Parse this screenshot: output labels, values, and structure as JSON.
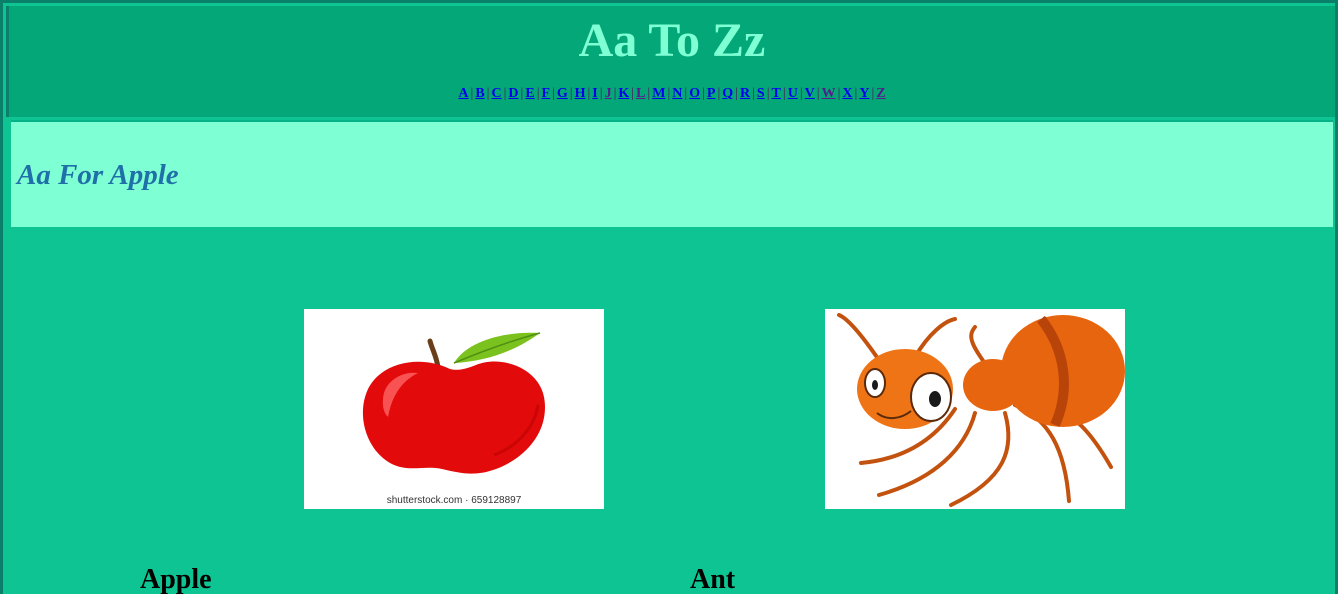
{
  "page": {
    "title": "Aa To Zz"
  },
  "nav": {
    "letters": [
      {
        "label": "A",
        "visited": false
      },
      {
        "label": "B",
        "visited": false
      },
      {
        "label": "C",
        "visited": false
      },
      {
        "label": "D",
        "visited": false
      },
      {
        "label": "E",
        "visited": false
      },
      {
        "label": "F",
        "visited": false
      },
      {
        "label": "G",
        "visited": false
      },
      {
        "label": "H",
        "visited": false
      },
      {
        "label": "I",
        "visited": false
      },
      {
        "label": "J",
        "visited": true
      },
      {
        "label": "K",
        "visited": false
      },
      {
        "label": "L",
        "visited": true
      },
      {
        "label": "M",
        "visited": false
      },
      {
        "label": "N",
        "visited": false
      },
      {
        "label": "O",
        "visited": false
      },
      {
        "label": "P",
        "visited": false
      },
      {
        "label": "Q",
        "visited": false
      },
      {
        "label": "R",
        "visited": false
      },
      {
        "label": "S",
        "visited": false
      },
      {
        "label": "T",
        "visited": false
      },
      {
        "label": "U",
        "visited": false
      },
      {
        "label": "V",
        "visited": false
      },
      {
        "label": "W",
        "visited": true
      },
      {
        "label": "X",
        "visited": false
      },
      {
        "label": "Y",
        "visited": false
      },
      {
        "label": "Z",
        "visited": true
      }
    ],
    "separator": "|"
  },
  "section": {
    "heading": "Aa For Apple"
  },
  "cards": {
    "apple": {
      "word": "Apple",
      "image_caption": "shutterstock.com · 659128897",
      "icon": "apple-picture"
    },
    "ant": {
      "word": "Ant",
      "icon": "ant-picture"
    }
  },
  "colors": {
    "header_bg": "#04a878",
    "title": "#7fffd4",
    "banner_bg": "#7fffd4",
    "banner_text": "#1f6fa8",
    "body_bg": "#0fc493",
    "link": "#0000ee",
    "link_visited": "#551a8b"
  }
}
